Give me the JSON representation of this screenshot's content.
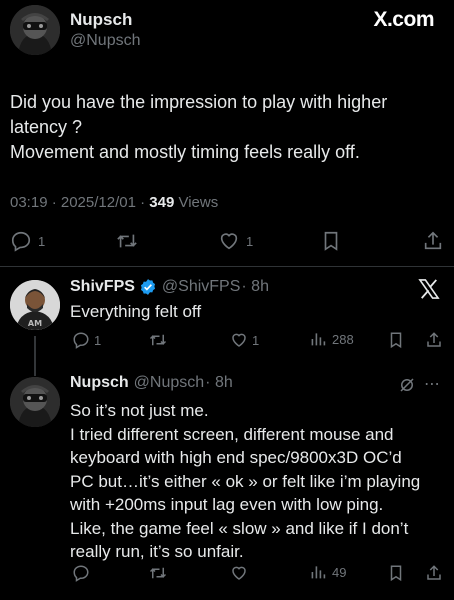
{
  "main_tweet": {
    "display_name": "Nupsch",
    "handle": "@Nupsch",
    "brand": "X.com",
    "text_lines": [
      "Did you have the impression to play with higher",
      "latency ?",
      "Movement and mostly timing feels really off."
    ],
    "time": "03:19 · 2025/12/01 · ",
    "views_count": "349",
    "views_label": " Views",
    "stats": {
      "replies": "1",
      "likes": "1"
    }
  },
  "reply1": {
    "display_name": "ShivFPS",
    "handle": "@ShivFPS",
    "age": "· 8h",
    "verified": true,
    "text": "Everything felt off",
    "stats": {
      "replies": "1",
      "likes": "1",
      "views": "288"
    }
  },
  "reply2": {
    "display_name": "Nupsch",
    "handle": "@Nupsch",
    "age": "· 8h",
    "text_lines": [
      "So it’s not just me.",
      "I tried different screen, different mouse and",
      "keyboard with high end spec/9800x3D OC’d",
      "PC but…it’s either « ok » or felt like i’m playing",
      "with +200ms input lag even with low ping.",
      "Like, the game feel « slow » and like if I don’t",
      "really run, it’s so unfair."
    ],
    "stats": {
      "views": "49"
    }
  },
  "colors": {
    "background": "#000000",
    "text": "#e7e9ea",
    "secondary": "#71767b",
    "verified": "#1d9bf0"
  }
}
